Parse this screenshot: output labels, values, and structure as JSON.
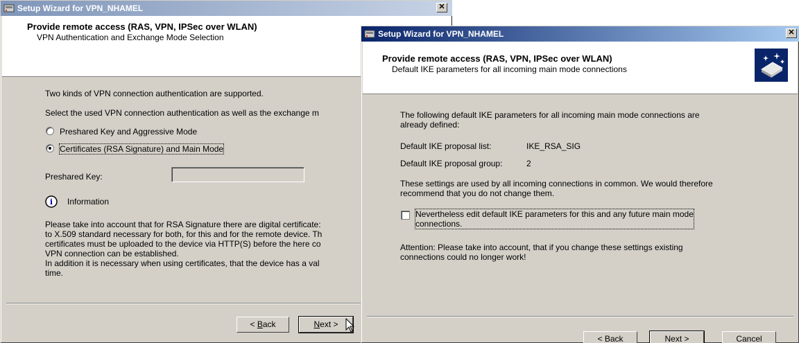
{
  "back_window": {
    "title": "Setup Wizard for VPN_NHAMEL",
    "header_title": "Provide remote access (RAS, VPN, IPSec over WLAN)",
    "header_subtitle": "VPN Authentication and Exchange Mode Selection",
    "intro_line1": "Two kinds of VPN connection authentication are supported.",
    "intro_line2": "Select the used VPN connection authentication as well as the exchange m",
    "radio_preshared": "Preshared Key and Aggressive Mode",
    "radio_certificates": "Certificates (RSA Signature) and Main Mode",
    "selected_option": "Certificates (RSA Signature) and Main Mode",
    "preshared_key_label": "Preshared Key:",
    "preshared_key_value": "",
    "info_label": "Information",
    "info_text": [
      "Please take into account that for RSA Signature there are digital certificate:",
      "to X.509 standard necessary for both, for this and for the remote device. Th",
      "certificates must be uploaded to the device via HTTP(S) before the here co",
      "VPN connection can be established.",
      "In addition it is necessary when using certificates, that the device has a val",
      "time."
    ],
    "back_label_pre": "< ",
    "back_label_accel": "B",
    "back_label_post": "ack",
    "next_label_accel": "N",
    "next_label_post": "ext >"
  },
  "front_window": {
    "title": "Setup Wizard for VPN_NHAMEL",
    "header_title": "Provide remote access (RAS, VPN, IPSec over WLAN)",
    "header_subtitle": "Default IKE parameters for all incoming main mode connections",
    "intro_line1": "The following default IKE parameters for all incoming main mode connections are",
    "intro_line2": "already defined:",
    "proposal_list_label": "Default IKE proposal list:",
    "proposal_list_value": "IKE_RSA_SIG",
    "proposal_group_label": "Default IKE proposal group:",
    "proposal_group_value": "2",
    "settings_note_line1": "These settings are used by all incoming connections in common. We would therefore",
    "settings_note_line2": "recommend that you do not change them.",
    "checkbox_line1": "Nevertheless edit default IKE parameters for this and any future main mode",
    "checkbox_line2": "connections.",
    "checkbox_checked": false,
    "attention_line1": "Attention: Please take into account, that if you change these settings existing",
    "attention_line2": "connections could no longer work!",
    "back_label": "< Back",
    "next_label": "Next >",
    "cancel_label": "Cancel"
  },
  "colors": {
    "active_title": "#0a246a",
    "inactive_title": "#7f95b8",
    "dialog_face": "#d4d0c8"
  }
}
